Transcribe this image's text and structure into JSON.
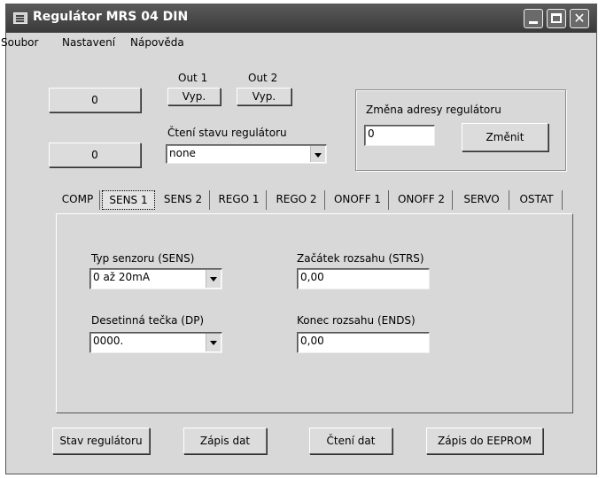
{
  "window": {
    "title": "Regulátor MRS 04 DIN"
  },
  "menu": [
    "Soubor",
    "Nastavení",
    "Nápověda"
  ],
  "displays": [
    "0",
    "0"
  ],
  "outputs": [
    {
      "label": "Out 1",
      "button": "Vyp."
    },
    {
      "label": "Out 2",
      "button": "Vyp."
    }
  ],
  "read_state": {
    "label": "Čtení stavu regulátoru",
    "value": "none"
  },
  "address": {
    "label": "Změna adresy regulátoru",
    "value": "0",
    "button": "Změnit"
  },
  "tabs": [
    "COMP",
    "SENS 1",
    "SENS 2",
    "REGO 1",
    "REGO 2",
    "ONOFF 1",
    "ONOFF 2",
    "SERVO",
    "OSTAT"
  ],
  "active_tab": "SENS 1",
  "sens": {
    "type_label": "Typ senzoru (SENS)",
    "type_value": "0 až 20mA",
    "dp_label": "Desetinná tečka (DP)",
    "dp_value": "0000.",
    "start_label": "Začátek rozsahu (STRS)",
    "start_value": "0,00",
    "end_label": "Konec rozsahu (ENDS)",
    "end_value": "0,00"
  },
  "buttons": [
    "Stav regulátoru",
    "Zápis dat",
    "Čtení dat",
    "Zápis do EEPROM"
  ]
}
